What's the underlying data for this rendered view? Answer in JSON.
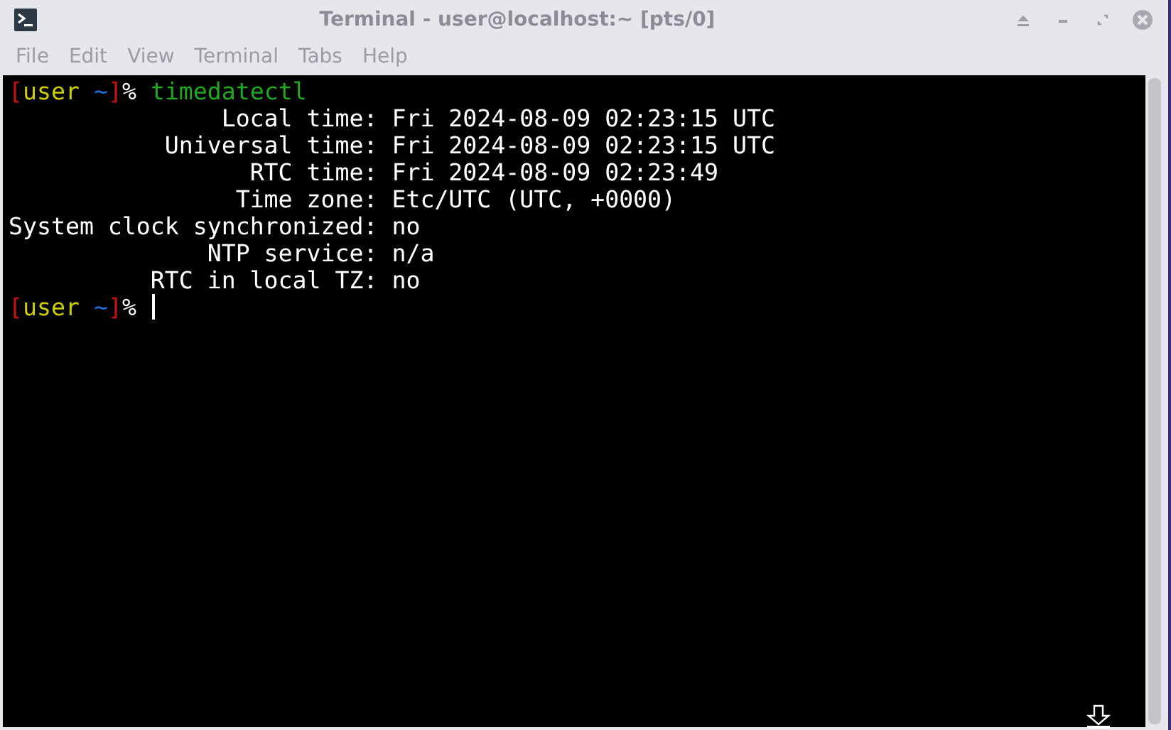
{
  "window": {
    "title": "Terminal - user@localhost:~ [pts/0]"
  },
  "menu": [
    "File",
    "Edit",
    "View",
    "Terminal",
    "Tabs",
    "Help"
  ],
  "terminal": {
    "lines": [
      {
        "kind": "prompt",
        "open": "[",
        "user": "user",
        "dir": "~",
        "close": "]",
        "symbol": "%",
        "command": "timedatectl",
        "cursor": false
      },
      {
        "kind": "field",
        "label": "Local time:",
        "value": "Fri 2024-08-09 02:23:15 UTC"
      },
      {
        "kind": "field",
        "label": "Universal time:",
        "value": "Fri 2024-08-09 02:23:15 UTC"
      },
      {
        "kind": "field",
        "label": "RTC time:",
        "value": "Fri 2024-08-09 02:23:49"
      },
      {
        "kind": "field",
        "label": "Time zone:",
        "value": "Etc/UTC (UTC, +0000)"
      },
      {
        "kind": "field",
        "label": "System clock synchronized:",
        "value": "no"
      },
      {
        "kind": "field",
        "label": "NTP service:",
        "value": "n/a"
      },
      {
        "kind": "field",
        "label": "RTC in local TZ:",
        "value": "no"
      },
      {
        "kind": "prompt",
        "open": "[",
        "user": "user",
        "dir": "~",
        "close": "]",
        "symbol": "%",
        "cursor": true
      }
    ]
  }
}
